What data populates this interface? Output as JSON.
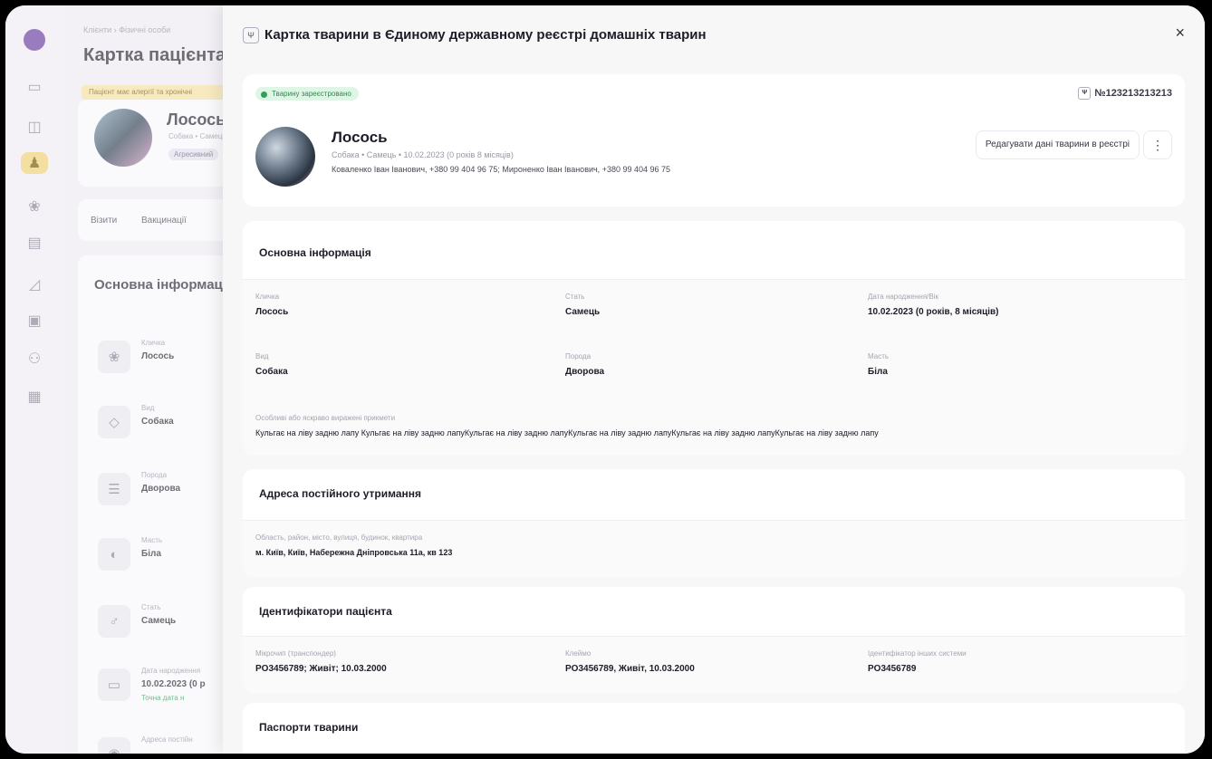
{
  "background": {
    "breadcrumb": "Клієнти  ›  Фізичні особи",
    "title": "Картка пацієнта",
    "warning": "Пацієнт має алергії та хронічні",
    "patient_name": "Лосось",
    "patient_sub": "Собака • Самець",
    "patient_tag": "Агресивний",
    "tabs": [
      "Візити",
      "Вакцинації"
    ],
    "info_title": "Основна інформація",
    "fields": [
      {
        "label": "Кличка",
        "value": "Лосось",
        "icon": "paw-icon"
      },
      {
        "label": "Вид",
        "value": "Собака",
        "icon": "species-icon"
      },
      {
        "label": "Порода",
        "value": "Дворова",
        "icon": "list-icon"
      },
      {
        "label": "Масть",
        "value": "Біла",
        "icon": "palette-icon"
      },
      {
        "label": "Стать",
        "value": "Самець",
        "icon": "male-icon"
      },
      {
        "label": "Дата народження",
        "value": "10.02.2023 (0 р",
        "icon": "calendar-icon"
      },
      {
        "label": "Адреса постійн",
        "value": "",
        "icon": "location-icon"
      }
    ],
    "exact_date_note": "Точна дата н"
  },
  "panel": {
    "title": "Картка тварини в Єдиному державному реєстрі домашніх тварин",
    "status_badge": "Тварину зареєстровано",
    "reg_number": "№123213213213",
    "animal_name": "Лосось",
    "animal_sub": "Собака • Самець • 10.02.2023 (0 років 8 місяців)",
    "owners": "Коваленко Іван Іванович, +380 99 404 96 75; Мироненко Іван Іванович, +380 99 404 96 75",
    "edit_label": "Редагувати дані тварини в реєстрі",
    "more_label": "⋮",
    "basic": {
      "title": "Основна інформація",
      "name_label": "Кличка",
      "name": "Лосось",
      "sex_label": "Стать",
      "sex": "Самець",
      "birth_label": "Дата народження/Вік",
      "birth": "10.02.2023 (0 років, 8 місяців)",
      "species_label": "Вид",
      "species": "Собака",
      "breed_label": "Порода",
      "breed": "Дворова",
      "color_label": "Масть",
      "color": "Біла",
      "marks_label": "Особливі або яскраво виражені прикмети",
      "marks": "Кульгає на ліву задню лапу Кульгає на ліву задню лапуКульгає на ліву задню лапуКульгає на ліву задню лапуКульгає на ліву задню лапуКульгає на ліву задню лапу"
    },
    "address": {
      "title": "Адреса постійного утримання",
      "label": "Область, район, місто, вулиця, будинок, квартира",
      "value": "м. Київ, Київ, Набережна Дніпровська 11а, кв 123"
    },
    "identifiers": {
      "title": "Ідентифікатори пацієнта",
      "chip_label": "Мікрочип (транспондер)",
      "chip": "PO3456789; Живіт; 10.03.2000",
      "brand_label": "Клеймо",
      "brand": "PO3456789, Живіт, 10.03.2000",
      "other_label": "Ідентифікатор інших системи",
      "other": "PO3456789"
    },
    "passports": {
      "title": "Паспорти тварини"
    },
    "close": "×"
  },
  "sidebar": {
    "icons": [
      "calendar-icon",
      "calendar-check-icon",
      "clients-icon",
      "paw-icon",
      "archive-icon",
      "chart-icon",
      "cash-icon",
      "users-icon",
      "briefcase-icon"
    ]
  }
}
